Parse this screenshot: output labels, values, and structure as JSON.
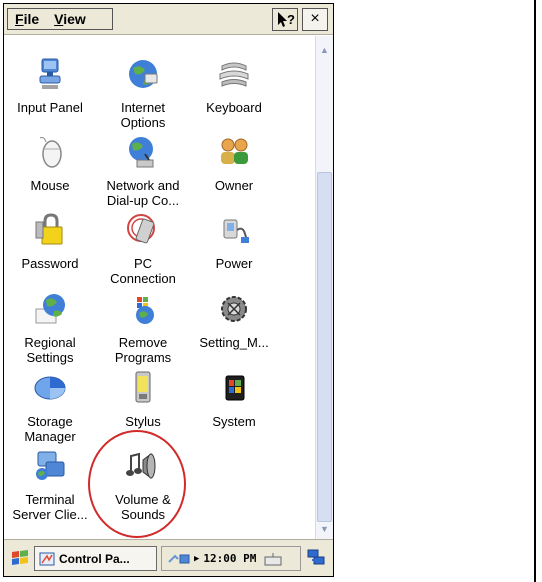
{
  "menu": {
    "file_label": "File",
    "file_access": "F",
    "view_label": "View",
    "view_access": "V"
  },
  "window": {
    "help_icon": "help-question-icon",
    "close_glyph": "×"
  },
  "items": [
    {
      "label": "Input Panel",
      "icon": "input-panel-icon"
    },
    {
      "label": "Internet\nOptions",
      "icon": "internet-options-icon"
    },
    {
      "label": "Keyboard",
      "icon": "keyboard-icon"
    },
    {
      "label": "Mouse",
      "icon": "mouse-icon"
    },
    {
      "label": "Network and\nDial-up Co...",
      "icon": "network-icon"
    },
    {
      "label": "Owner",
      "icon": "owner-icon"
    },
    {
      "label": "Password",
      "icon": "password-icon"
    },
    {
      "label": "PC\nConnection",
      "icon": "pc-connection-icon"
    },
    {
      "label": "Power",
      "icon": "power-icon"
    },
    {
      "label": "Regional\nSettings",
      "icon": "regional-settings-icon"
    },
    {
      "label": "Remove\nPrograms",
      "icon": "remove-programs-icon"
    },
    {
      "label": "Setting_M...",
      "icon": "setting-m-icon"
    },
    {
      "label": "Storage\nManager",
      "icon": "storage-manager-icon"
    },
    {
      "label": "Stylus",
      "icon": "stylus-icon"
    },
    {
      "label": "System",
      "icon": "system-icon"
    },
    {
      "label": "Terminal\nServer Clie...",
      "icon": "terminal-server-icon"
    },
    {
      "label": "Volume &\nSounds",
      "icon": "volume-sounds-icon"
    }
  ],
  "taskbar": {
    "task_label": "Control Pa...",
    "clock": "12:00 PM"
  },
  "colors": {
    "highlight": "#d12a2a",
    "chrome": "#ece9d8"
  }
}
